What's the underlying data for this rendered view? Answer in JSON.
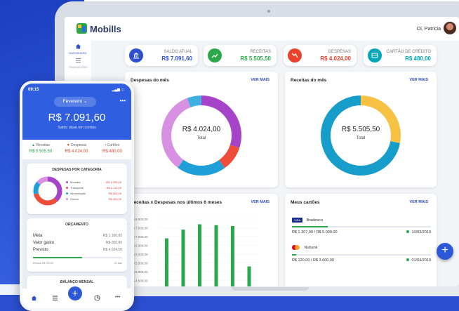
{
  "app": {
    "name": "Mobills",
    "greeting": "Oi, Patricia"
  },
  "sidebar": {
    "items": [
      {
        "label": "DASHBOARD",
        "icon": "home-icon"
      },
      {
        "label": "TRANSAÇÕES",
        "icon": "list-icon"
      }
    ]
  },
  "stats": [
    {
      "label": "SALDO ATUAL",
      "value": "R$ 7.091,60",
      "color": "#2d4fd0",
      "icon": "bank-icon"
    },
    {
      "label": "RECEITAS",
      "value": "R$ 5.505,50",
      "color": "#2aa84a",
      "icon": "trend-up-icon"
    },
    {
      "label": "DESPESAS",
      "value": "R$ 4.024,00",
      "color": "#e8412c",
      "icon": "trend-down-icon"
    },
    {
      "label": "CARTÃO DE CRÉDITO",
      "value": "R$ 480,00",
      "color": "#00a7b7",
      "icon": "credit-card-icon"
    }
  ],
  "despesas": {
    "title": "Despesas do mês",
    "link": "VER MAIS",
    "value": "R$ 4.024,00",
    "total_label": "Total",
    "segments": [
      {
        "fraction": 0.3,
        "color": "#a544c9"
      },
      {
        "fraction": 0.1,
        "color": "#ef4c3a"
      },
      {
        "fraction": 0.2,
        "color": "#1f9fd8"
      },
      {
        "fraction": 0.34,
        "color": "#d890e2"
      },
      {
        "fraction": 0.06,
        "color": "#3fb0e0"
      }
    ]
  },
  "receitas": {
    "title": "Receitas do mês",
    "link": "VER MAIS",
    "value": "R$ 5.505,50",
    "total_label": "Total",
    "segments": [
      {
        "fraction": 0.28,
        "color": "#f7c244"
      },
      {
        "fraction": 0.72,
        "color": "#179dc9"
      }
    ]
  },
  "chart_data": {
    "type": "bar",
    "title": "Receitas x Despesas nos últimos 6 meses",
    "link": "VER MAIS",
    "y_ticks": [
      "R$ 8.000,00",
      "R$ 7.500,00",
      "R$ 7.000,00",
      "R$ 6.500,00",
      "R$ 6.000,00",
      "R$ 5.500,00",
      "R$ 5.000,00",
      "R$ 4.500,00"
    ],
    "ylim": [
      4500,
      8000
    ],
    "series": [
      {
        "color": "#2aa84a",
        "values": [
          6900,
          7400,
          7700,
          7650,
          7600,
          5300
        ]
      }
    ]
  },
  "cartoes": {
    "title": "Meus cartões",
    "link": "VER MAIS",
    "items": [
      {
        "name": "Bradesco",
        "brand": "VISA",
        "spent": "R$ 1.307,90",
        "limit": "R$ 5.000,00",
        "date": "10/03/2019",
        "progress": 0.26
      },
      {
        "name": "Nubank",
        "brand": "mastercard",
        "spent": "R$ 120,00",
        "limit": "R$ 3.600,00",
        "date": "01/04/2019",
        "progress": 0.03
      }
    ]
  },
  "phone": {
    "time": "09:15",
    "month": "Fevereiro",
    "balance": "R$ 7.091,60",
    "balance_label": "Saldo atual em contas",
    "summary": [
      {
        "label": "Receitas",
        "value": "R$ 5.505,50",
        "color": "#2aa84a"
      },
      {
        "label": "Despesas",
        "value": "R$ 4.024,00",
        "color": "#e8412c"
      },
      {
        "label": "Cartões",
        "value": "R$ 480,00",
        "color": "#e8412c"
      }
    ],
    "categorias": {
      "title": "DESPESAS POR CATEGORIA",
      "items": [
        {
          "label": "Moradia",
          "value": "R$ 1.290,00",
          "color": "#a544c9"
        },
        {
          "label": "Transporte",
          "value": "R$ 1.110,00",
          "color": "#ef4c3a"
        },
        {
          "label": "Alimentação",
          "value": "R$ 500,00",
          "color": "#1f9fd8"
        },
        {
          "label": "Outros",
          "value": "R$ 400,00",
          "color": "#d890e2"
        }
      ]
    },
    "orcamento": {
      "title": "ORÇAMENTO",
      "rows": [
        {
          "label": "Meta",
          "value": "R$ 1.100,00"
        },
        {
          "label": "Valor gasto",
          "value": "R$ 200,00"
        },
        {
          "label": "Previsto",
          "value": "R$ 4.024,50"
        }
      ],
      "progress": 0.55,
      "foot_left": "Restam R$ 700,00",
      "foot_right": "31 dias"
    },
    "balanco": {
      "title": "BALANÇO MENSAL"
    }
  }
}
